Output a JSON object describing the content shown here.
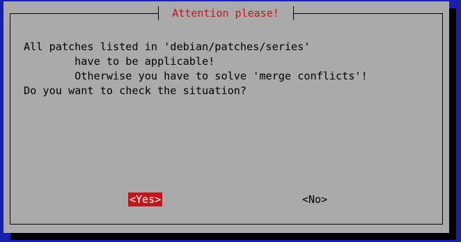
{
  "dialog": {
    "title": "Attention please!",
    "message_lines": [
      "All patches listed in 'debian/patches/series'",
      "        have to be applicable!",
      "        Otherwise you have to solve 'merge conflicts'!",
      "Do you want to check the situation?"
    ],
    "buttons": {
      "yes_label": "<Yes>",
      "no_label": "<No>",
      "selected": "yes"
    }
  },
  "colors": {
    "screen_background": "#1a1fb0",
    "dialog_background": "#aaaaaa",
    "shadow": "#000000",
    "title_text": "#c0171b",
    "selected_button_background": "#c0171b",
    "selected_button_text": "#ffffff"
  }
}
